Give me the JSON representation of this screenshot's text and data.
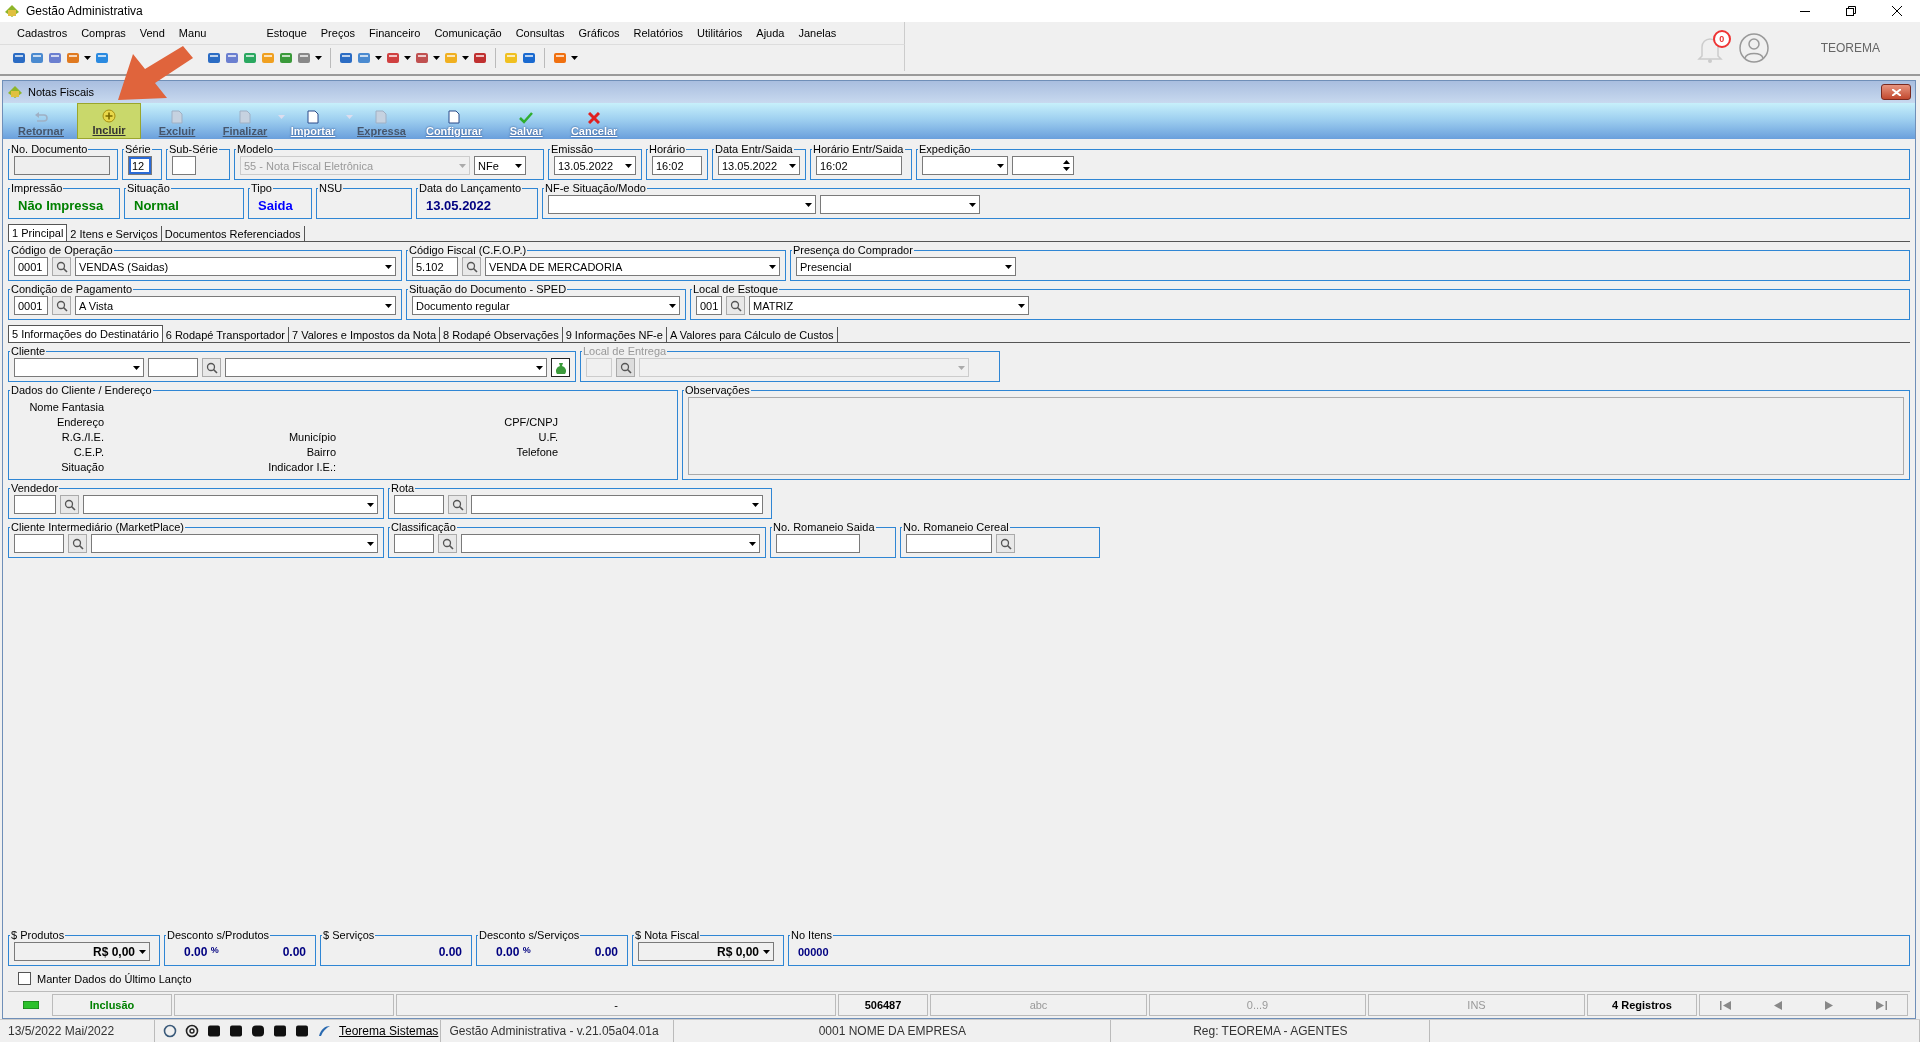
{
  "app": {
    "title": "Gestão Administrativa"
  },
  "menu": [
    "Cadastros",
    "Compras",
    "Vend",
    "Manu",
    "Estoque",
    "Preços",
    "Financeiro",
    "Comunicação",
    "Consultas",
    "Gráficos",
    "Relatórios",
    "Utilitários",
    "Ajuda",
    "Janelas"
  ],
  "user": {
    "notifications": "0",
    "name": "TEOREMA"
  },
  "form": {
    "title": "Notas Fiscais"
  },
  "actions": [
    {
      "label": "Retornar",
      "disabled": true,
      "selected": false,
      "dropdown": false
    },
    {
      "label": "Incluir",
      "disabled": false,
      "selected": true,
      "dropdown": false
    },
    {
      "label": "Excluir",
      "disabled": true,
      "selected": false,
      "dropdown": false
    },
    {
      "label": "Finalizar",
      "disabled": true,
      "selected": false,
      "dropdown": true
    },
    {
      "label": "Importar",
      "disabled": false,
      "selected": false,
      "dropdown": true
    },
    {
      "label": "Expressa",
      "disabled": true,
      "selected": false,
      "dropdown": false
    },
    {
      "label": "Configurar",
      "disabled": false,
      "selected": false,
      "dropdown": false
    },
    {
      "label": "Salvar",
      "disabled": false,
      "selected": false,
      "dropdown": false
    },
    {
      "label": "Cancelar",
      "disabled": false,
      "selected": false,
      "dropdown": false
    }
  ],
  "header": {
    "no_documento": {
      "label": "No. Documento"
    },
    "serie": {
      "label": "Série",
      "value": "12"
    },
    "sub_serie": {
      "label": "Sub-Série"
    },
    "modelo": {
      "label": "Modelo",
      "value": "55 - Nota Fiscal Eletrônica",
      "type": "NFe"
    },
    "emissao": {
      "label": "Emissão",
      "value": "13.05.2022"
    },
    "horario": {
      "label": "Horário",
      "value": "16:02"
    },
    "data_entr_saida": {
      "label": "Data Entr/Saida",
      "value": "13.05.2022"
    },
    "horario_entr_saida": {
      "label": "Horário Entr/Saida",
      "value": "16:02"
    },
    "expedicao": {
      "label": "Expedição"
    }
  },
  "info": [
    {
      "label": "Impressão",
      "value": "Não Impressa",
      "color": "#008000"
    },
    {
      "label": "Situação",
      "value": "Normal",
      "color": "#008000"
    },
    {
      "label": "Tipo",
      "value": "Saida",
      "color": "#0000ff"
    },
    {
      "label": "NSU"
    },
    {
      "label": "Data do Lançamento",
      "value": "13.05.2022",
      "color": "#000080"
    }
  ],
  "nfe_situacao": {
    "label": "NF-e Situação/Modo"
  },
  "main_tabs": [
    {
      "label": "1 Principal",
      "selected": true
    },
    {
      "label": "2 Itens e Serviços",
      "selected": false
    },
    {
      "label": "Documentos Referenciados",
      "selected": false
    }
  ],
  "operacao": {
    "label": "Código de Operação",
    "code": "0001",
    "value": "VENDAS (Saidas)"
  },
  "cfop": {
    "label": "Código Fiscal (C.F.O.P.)",
    "code": "5.102",
    "value": "VENDA DE MERCADORIA"
  },
  "presenca": {
    "label": "Presença do Comprador",
    "value": "Presencial"
  },
  "pagamento": {
    "label": "Condição de Pagamento",
    "code": "0001",
    "value": "A Vista"
  },
  "sped": {
    "label": "Situação do Documento - SPED",
    "value": "Documento regular"
  },
  "estoque": {
    "label": "Local de Estoque",
    "code": "001",
    "value": "MATRIZ"
  },
  "sub_tabs": [
    {
      "label": "5 Informações do Destinatário",
      "selected": true
    },
    {
      "label": "6 Rodapé Transportador",
      "selected": false
    },
    {
      "label": "7 Valores e Impostos da Nota",
      "selected": false
    },
    {
      "label": "8 Rodapé Observações",
      "selected": false
    },
    {
      "label": "9 Informações NF-e",
      "selected": false
    },
    {
      "label": "A Valores para Cálculo de Custos",
      "selected": false
    }
  ],
  "cliente": {
    "label": "Cliente"
  },
  "local_entrega": {
    "label": "Local de Entrega",
    "disabled": true
  },
  "dados_cliente": {
    "label": "Dados do Cliente / Endereço",
    "rows": [
      {
        "col1": "Nome Fantasia"
      },
      {
        "col1": "Endereço",
        "col3": "CPF/CNPJ"
      },
      {
        "col1": "R.G./I.E.",
        "col2": "Município",
        "col3": "U.F."
      },
      {
        "col1": "C.E.P.",
        "col2": "Bairro",
        "col3": "Telefone"
      },
      {
        "col1": "Situação",
        "col2": "Indicador I.E.:"
      }
    ]
  },
  "observacoes": {
    "label": "Observações"
  },
  "vendedor": {
    "label": "Vendedor"
  },
  "rota": {
    "label": "Rota"
  },
  "intermediario": {
    "label": "Cliente Intermediário (MarketPlace)"
  },
  "classificacao": {
    "label": "Classificação"
  },
  "romaneio_saida": {
    "label": "No. Romaneio Saida"
  },
  "romaneio_cereal": {
    "label": "No. Romaneio Cereal"
  },
  "totals": [
    {
      "kind": "money",
      "label": "$ Produtos",
      "value": "R$ 0,00"
    },
    {
      "kind": "discount",
      "label": "Desconto s/Produtos",
      "percent": "0.00",
      "unit": "%",
      "value": "0.00"
    },
    {
      "kind": "amount",
      "label": "$ Serviços",
      "value": "0.00"
    },
    {
      "kind": "discount",
      "label": "Desconto s/Serviços",
      "percent": "0.00",
      "unit": "%",
      "value": "0.00"
    },
    {
      "kind": "money",
      "label": "$ Nota Fiscal",
      "value": "R$ 0,00"
    },
    {
      "kind": "count",
      "label": "No Itens",
      "value": "00000"
    }
  ],
  "keep_data": {
    "label": "Manter Dados do Último Lançto",
    "checked": false
  },
  "status": {
    "mode": "Inclusão",
    "center": "-",
    "number": "506487",
    "indicators": [
      "abc",
      "0...9",
      "INS"
    ],
    "records": "4 Registros"
  },
  "footer": {
    "date": "13/5/2022 Mai/2022",
    "link": "Teorema Sistemas",
    "version": "Gestão Administrativa - v.21.05a04.01a",
    "company": "0001 NOME DA EMPRESA",
    "reg": "Reg: TEOREMA - AGENTES"
  }
}
